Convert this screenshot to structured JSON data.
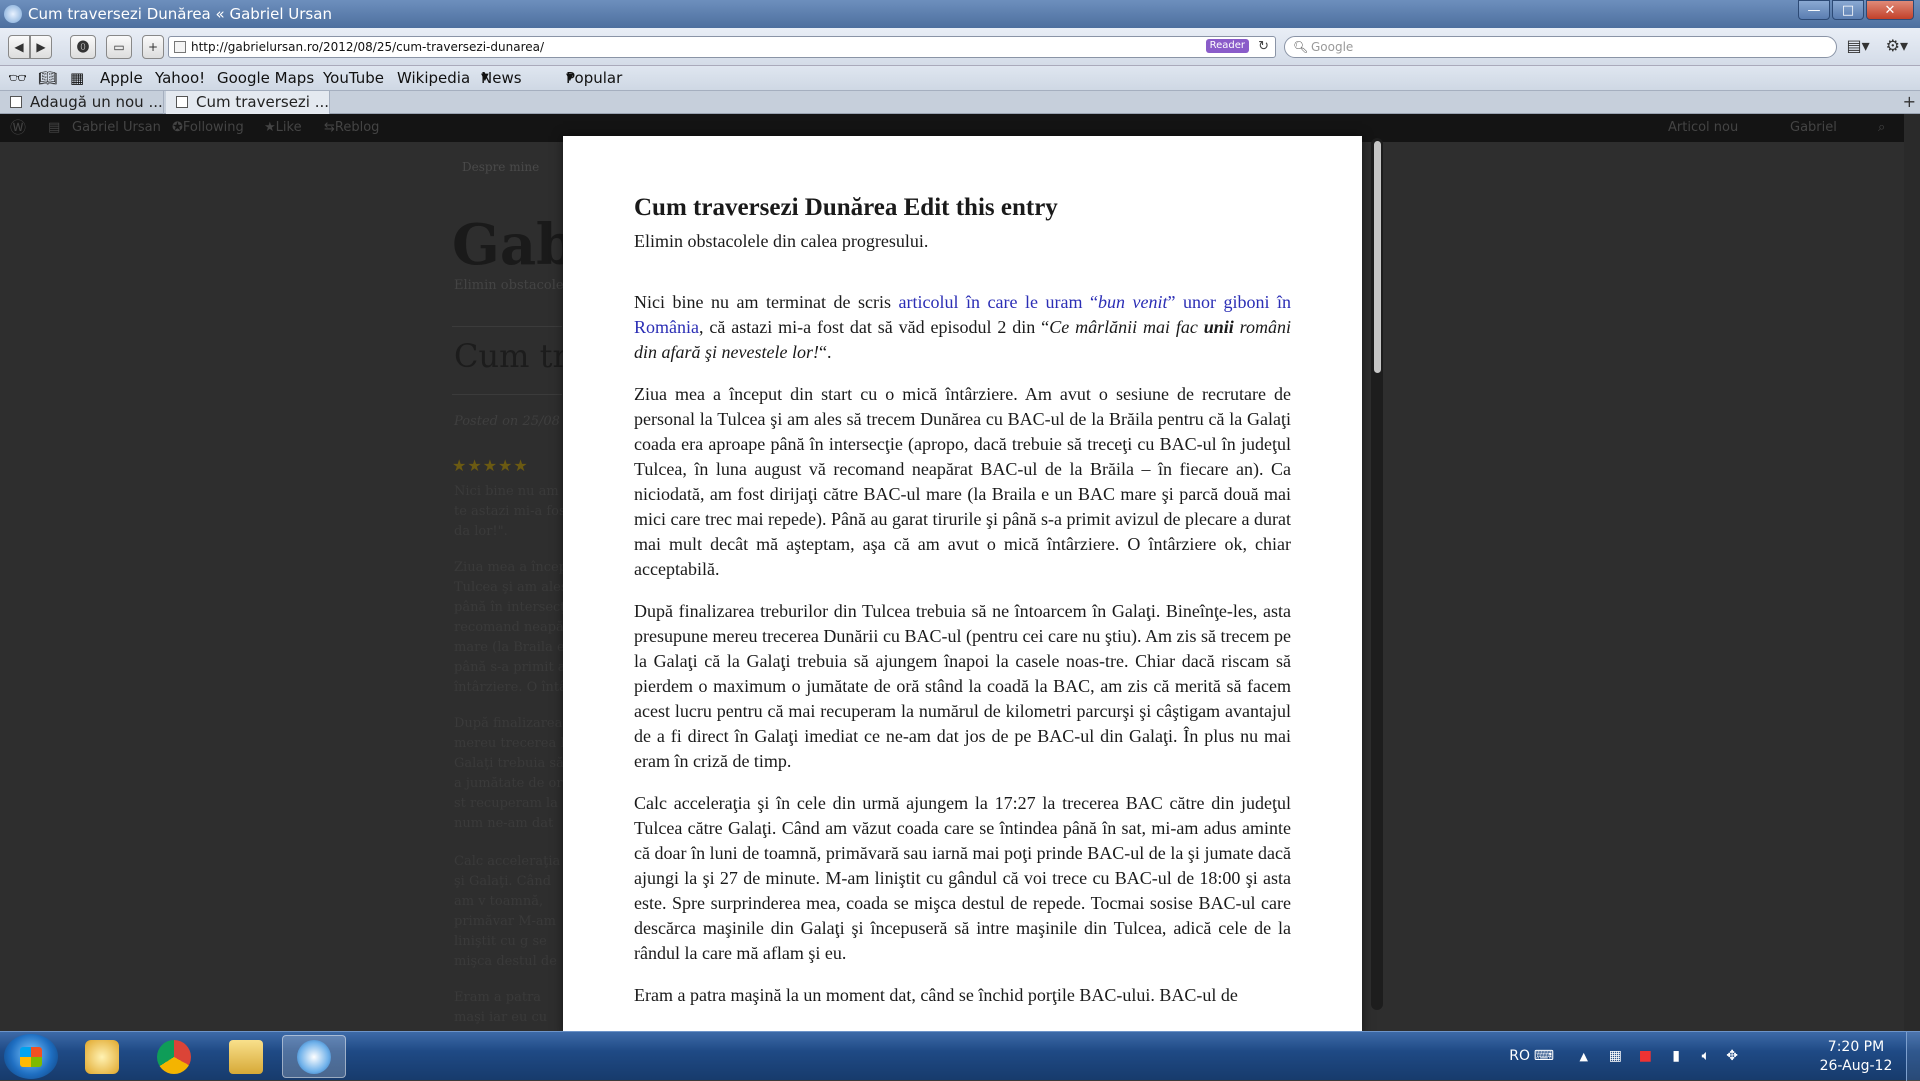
{
  "window": {
    "title": "Cum traversezi Dunărea « Gabriel Ursan",
    "minimize": "—",
    "maximize": "□",
    "close": "✕"
  },
  "toolbar": {
    "back": "◀",
    "forward": "▶",
    "url": "http://gabrielursan.ro/2012/08/25/cum-traversezi-dunarea/",
    "reader_label": "Reader",
    "search_placeholder": "Google"
  },
  "bookmarks": {
    "items": [
      "Apple",
      "Yahoo!",
      "Google Maps",
      "YouTube",
      "Wikipedia",
      "News (3)",
      "Popular"
    ]
  },
  "tabs": [
    {
      "label": "Adaugă un nou ..."
    },
    {
      "label": "Cum traversezi ..."
    }
  ],
  "wp_bar": {
    "site": "Gabriel Ursan",
    "following": "Following",
    "like": "Like",
    "reblog": "Reblog",
    "new_post": "Articol nou",
    "user": "Gabriel"
  },
  "background_site": {
    "menu": "Despre mine",
    "logo": "Gabr",
    "tagline": "Elimin obstacolele",
    "post_title": "Cum tra",
    "posted_on": "Posted on 25/08",
    "excerpts": [
      "Nici bine nu am te astazi mi-a fost da lor!\".",
      "Ziua mea a încep Tulcea şi am ales până în intersecţi recomand neapăr mare (la Braila e până s-a primit av întârziere. O întâ",
      "După finalizarea t mereu trecerea D Galaţi trebuia să a jumătate de oră st recuperam la num ne-am dat jos de p",
      "Calc acceleraţia şi Galaţi. Când am v toamnă, primăvar M-am liniştit cu g se mişca destul de intre maşinile din",
      "Eram a patra maşi iar eu cu cele 3 m"
    ]
  },
  "article": {
    "title": "Cum traversezi Dunărea Edit this entry",
    "subtitle": "Elimin obstacolele din calea progresului.",
    "p1_a": "Nici bine nu am terminat de scris ",
    "p1_link_a": "articolul în care le uram “",
    "p1_link_em": "bun venit",
    "p1_link_b": "” unor giboni în România",
    "p1_b": ", că astazi mi-a fost dat să văd episodul 2 din “",
    "p1_em_a": "Ce mârlănii mai fac ",
    "p1_strong": "unii",
    "p1_em_b": " români din afară şi nevestele lor!",
    "p1_c": "“.",
    "p2": "Ziua mea a început din start cu o mică întârziere. Am avut o sesiune de recrutare de personal la Tulcea şi am ales să trecem Dunărea cu BAC-ul de la Brăila pentru că la Galaţi coada era aproape până în intersecţie (apropo, dacă trebuie să treceţi cu BAC-ul în judeţul Tulcea, în luna august vă recomand neapărat BAC-ul de la Brăila – în fiecare an). Ca niciodată, am fost dirijaţi către BAC-ul mare (la Braila e un BAC mare şi parcă două mai mici care trec mai repede). Până au garat tirurile şi până s-a primit avizul de plecare a durat mai mult decât mă aşteptam, aşa că am avut o mică întârziere. O întârziere ok, chiar acceptabilă.",
    "p3": "După finalizarea treburilor din Tulcea trebuia să ne întoarcem în Galaţi. Bineînţe-les, asta presupune mereu trecerea Dunării cu BAC-ul (pentru cei care nu ştiu). Am zis să trecem pe la Galaţi că la Galaţi trebuia să ajungem înapoi la casele noas-tre. Chiar dacă riscam să pierdem o maximum o jumătate de oră stând la coadă la BAC, am zis că merită să facem acest lucru pentru că mai recuperam la numărul de kilometri parcurşi şi câştigam avantajul de a fi direct în Galaţi imediat ce ne-am dat jos de pe BAC-ul din Galaţi. În plus nu mai eram în criză de timp.",
    "p4": "Calc acceleraţia şi în cele din urmă ajungem la 17:27 la trecerea BAC către din judeţul Tulcea către Galaţi. Când am văzut coada care se întindea până în sat, mi-am adus aminte că doar în luni de toamnă, primăvară sau iarnă mai poţi prinde BAC-ul de la şi jumate dacă ajungi la şi 27 de minute. M-am liniştit cu gândul că voi trece cu BAC-ul de 18:00 şi asta este. Spre surprinderea mea, coada se mişca destul de repede. Tocmai sosise BAC-ul care descărca maşinile din Galaţi şi începuseră să intre maşinile din Tulcea, adică cele de la rândul la care mă aflam şi eu.",
    "p5": "Eram a patra maşină la un moment dat, când se închid porţile BAC-ului. BAC-ul de"
  },
  "taskbar": {
    "lang": "RO",
    "time": "7:20 PM",
    "date": "26-Aug-12"
  },
  "colors": {
    "link": "#2b2eb5",
    "reader_badge": "#8a5cc9",
    "taskbar": "#1f4a85"
  }
}
